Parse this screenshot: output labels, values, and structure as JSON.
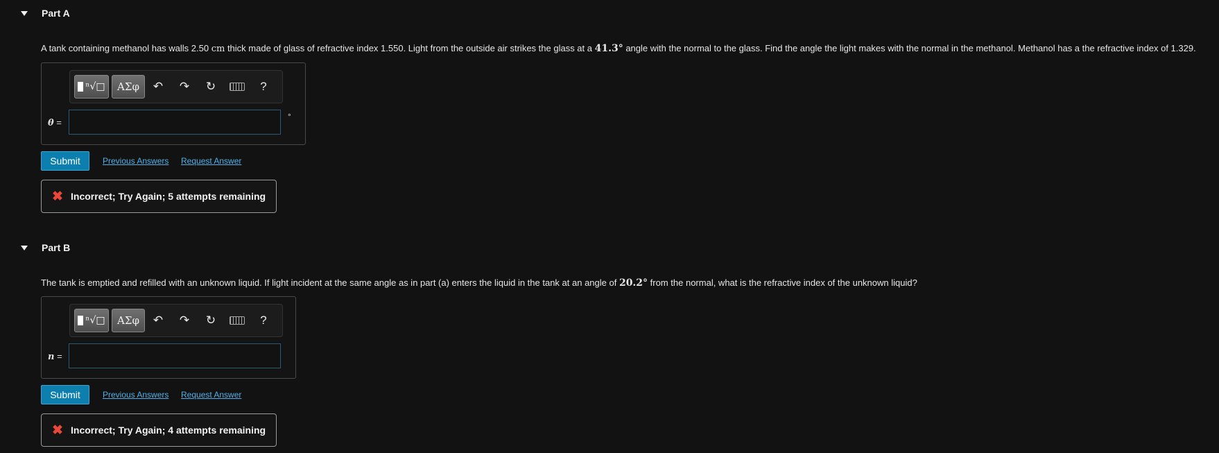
{
  "part_a": {
    "title": "Part A",
    "question_before": "A tank containing methanol has walls 2.50 ",
    "question_unit": "cm",
    "question_mid": " thick made of glass of refractive index 1.550. Light from the outside air strikes the glass at a ",
    "question_angle": "41.3°",
    "question_after": " angle with the normal to the glass. Find the angle the light makes with the normal in the methanol. Methanol has a the refractive index of 1.329.",
    "answer_label": "θ",
    "answer_equals": " =",
    "answer_value": "",
    "answer_unit": "°",
    "submit_label": "Submit",
    "previous_answers_label": "Previous Answers",
    "request_answer_label": "Request Answer",
    "feedback_text": "Incorrect; Try Again; 5 attempts remaining"
  },
  "part_b": {
    "title": "Part B",
    "question_before": "The tank is emptied and refilled with an unknown liquid. If light incident at the same angle as in part (a) enters the liquid in the tank at an angle of ",
    "question_angle": "20.2°",
    "question_after": " from the normal, what is the refractive index of the unknown liquid?",
    "answer_label": "n",
    "answer_equals": " =",
    "answer_value": "",
    "submit_label": "Submit",
    "previous_answers_label": "Previous Answers",
    "request_answer_label": "Request Answer",
    "feedback_text": "Incorrect; Try Again; 4 attempts remaining"
  },
  "toolbar": {
    "greek_label": "ΑΣφ",
    "help_label": "?",
    "undo_glyph": "↶",
    "redo_glyph": "↷",
    "reset_glyph": "↻",
    "templates_glyph": "ⁿ√□",
    "feedback_icon": "✖"
  }
}
